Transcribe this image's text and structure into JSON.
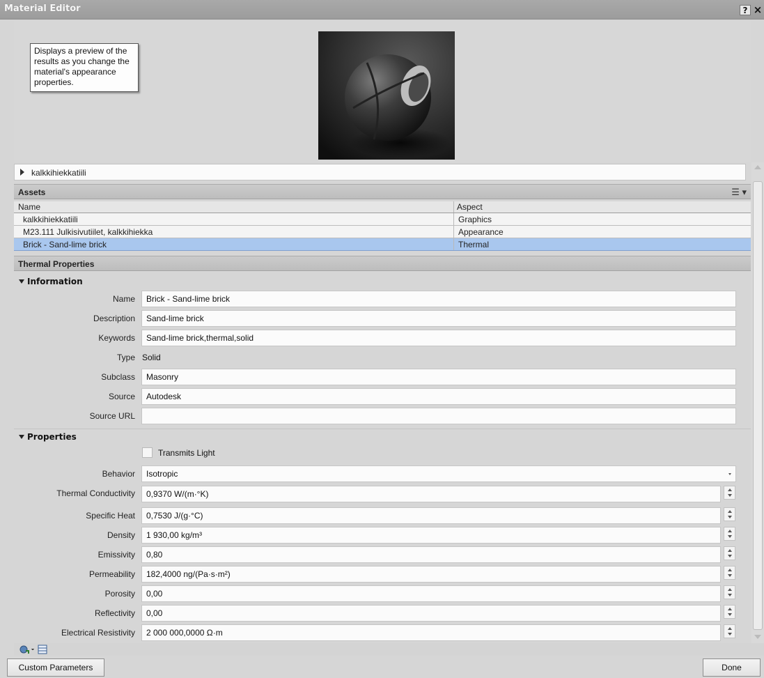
{
  "window": {
    "title": "Material Editor",
    "help_label": "?",
    "close_label": "×"
  },
  "preview": {
    "tooltip": "Displays a preview of the results as you change the material's appearance properties."
  },
  "path_bar": {
    "label": "kalkkihiekkatiili"
  },
  "assets": {
    "title": "Assets",
    "view_icon": "list-view-icon",
    "columns": [
      "Name",
      "Aspect"
    ],
    "rows": [
      {
        "name": "kalkkihiekkatiili",
        "aspect": "Graphics"
      },
      {
        "name": "M23.111 Julkisivutiilet, kalkkihiekka",
        "aspect": "Appearance"
      },
      {
        "name": "Brick - Sand-lime brick",
        "aspect": "Thermal"
      }
    ],
    "selected_index": 2
  },
  "thermal": {
    "title": "Thermal Properties",
    "information": {
      "title": "Information",
      "fields": {
        "name": {
          "label": "Name",
          "value": "Brick - Sand-lime brick"
        },
        "description": {
          "label": "Description",
          "value": "Sand-lime brick"
        },
        "keywords": {
          "label": "Keywords",
          "value": "Sand-lime brick,thermal,solid"
        },
        "type": {
          "label": "Type",
          "value": "Solid"
        },
        "subclass": {
          "label": "Subclass",
          "value": "Masonry"
        },
        "source": {
          "label": "Source",
          "value": "Autodesk"
        },
        "source_url": {
          "label": "Source URL",
          "value": ""
        }
      }
    },
    "properties": {
      "title": "Properties",
      "transmits_light": {
        "label": "Transmits Light",
        "checked": false
      },
      "behavior": {
        "label": "Behavior",
        "value": "Isotropic"
      },
      "numeric": [
        {
          "label": "Thermal Conductivity",
          "value": "0,9370 W/(m·°K)"
        },
        {
          "label": "Specific Heat",
          "value": "0,7530 J/(g·°C)"
        },
        {
          "label": "Density",
          "value": "1 930,00 kg/m³"
        },
        {
          "label": "Emissivity",
          "value": "0,80"
        },
        {
          "label": "Permeability",
          "value": "182,4000 ng/(Pa·s·m²)"
        },
        {
          "label": "Porosity",
          "value": "0,00"
        },
        {
          "label": "Reflectivity",
          "value": "0,00"
        },
        {
          "label": "Electrical Resistivity",
          "value": "2 000 000,0000 Ω·m"
        }
      ]
    }
  },
  "footer": {
    "custom_parameters": "Custom Parameters",
    "done": "Done"
  },
  "colors": {
    "selection": "#a9c7ee",
    "title_bar": "#a3a3a3"
  }
}
